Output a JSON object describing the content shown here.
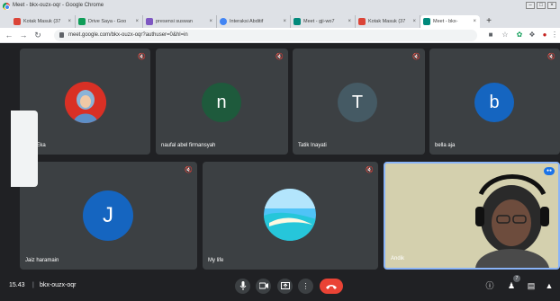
{
  "window": {
    "title": "Meet - bkx-ouzx-oqr - Google Chrome",
    "controls": [
      "–",
      "□",
      "×"
    ]
  },
  "tabs": [
    {
      "label": "Kotak Masuk (37",
      "favicon_color": "#db4437"
    },
    {
      "label": "Drive Saya - Goo",
      "favicon_color": "#0f9d58"
    },
    {
      "label": "presensi suswan",
      "favicon_color": "#7e57c2"
    },
    {
      "label": "Interaksi Abditif",
      "favicon_color": "#4285f4"
    },
    {
      "label": "Meet - gji-wo7",
      "favicon_color": "#00897b"
    },
    {
      "label": "Kotak Masuk (37",
      "favicon_color": "#db4437"
    },
    {
      "label": "Meet - bkx-",
      "favicon_color": "#00897b"
    }
  ],
  "address": {
    "url": "meet.google.com/bkx-ouzx-oqr?authuser=0&hl=in"
  },
  "tiles": [
    {
      "name": "Sira Eka",
      "avatar_type": "photo",
      "avatar_bg": "#d93025"
    },
    {
      "name": "naufal abel firmansyah",
      "initial": "n",
      "avatar_bg": "#1e5a3c"
    },
    {
      "name": "Tatik Inayati",
      "initial": "T",
      "avatar_bg": "#455a64"
    },
    {
      "name": "bella aja",
      "initial": "b",
      "avatar_bg": "#1565c0"
    },
    {
      "name": "Jaiz haramain",
      "initial": "J",
      "avatar_bg": "#1565c0"
    },
    {
      "name": "My life",
      "avatar_type": "photo",
      "avatar_bg": "#4fc3f7"
    },
    {
      "name": "Andik",
      "avatar_type": "video"
    }
  ],
  "bottom": {
    "time": "15.43",
    "separator": "|",
    "meeting_code": "bkx-ouzx-oqr",
    "people_count": "7"
  },
  "colors": {
    "meet_bg": "#202124",
    "tile_bg": "#3c4043",
    "hangup": "#ea4335",
    "active_speaker_border": "#8ab4f8"
  }
}
